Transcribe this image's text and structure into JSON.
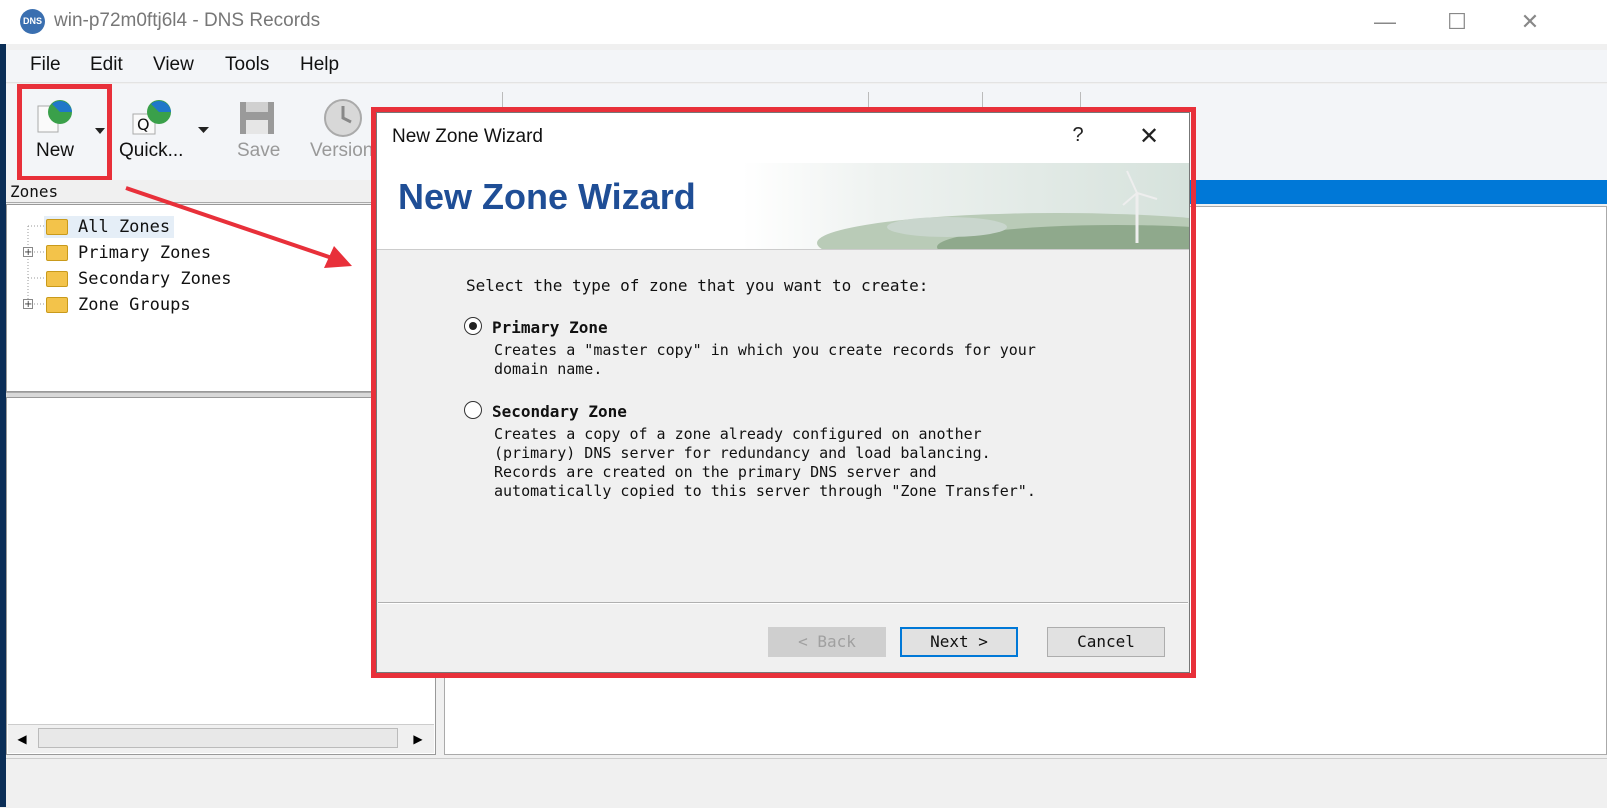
{
  "window": {
    "title": "win-p72m0ftj6l4 - DNS Records",
    "icon_text": "DNS",
    "controls": {
      "minimize": "—",
      "maximize": "☐",
      "close": "✕"
    }
  },
  "menu": [
    "File",
    "Edit",
    "View",
    "Tools",
    "Help"
  ],
  "toolbar": {
    "new_label": "New",
    "quick_label": "Quick...",
    "save_label": "Save",
    "version_label": "Version"
  },
  "tree": {
    "header": "Zones",
    "items": [
      "All Zones",
      "Primary Zones",
      "Secondary Zones",
      "Zone Groups"
    ]
  },
  "scroll": {
    "left": "◀",
    "right": "▶"
  },
  "dialog": {
    "title": "New Zone Wizard",
    "help": "?",
    "close": "✕",
    "banner_title": "New Zone Wizard",
    "prompt": "Select the type of zone that you want to create:",
    "options": [
      {
        "label": "Primary Zone",
        "selected": true,
        "desc": [
          "Creates a \"master copy\" in which you create records for your",
          "domain name."
        ]
      },
      {
        "label": "Secondary Zone",
        "selected": false,
        "desc": [
          "Creates a copy of a zone already configured on another",
          "(primary) DNS server for redundancy and load balancing.",
          "Records are created on the primary DNS server and",
          "automatically copied to this server through \"Zone Transfer\"."
        ]
      }
    ],
    "buttons": {
      "back": "< Back",
      "next": "Next >",
      "cancel": "Cancel"
    }
  },
  "colors": {
    "highlight": "#e8303a",
    "accent": "#0078d7",
    "heading": "#1f4e96"
  }
}
